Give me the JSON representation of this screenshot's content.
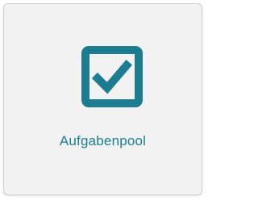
{
  "tile": {
    "label": "Aufgabenpool",
    "icon": "checkbox-checked-icon",
    "accent_color": "#1d7c8f",
    "background_color": "#f2f2f2"
  }
}
